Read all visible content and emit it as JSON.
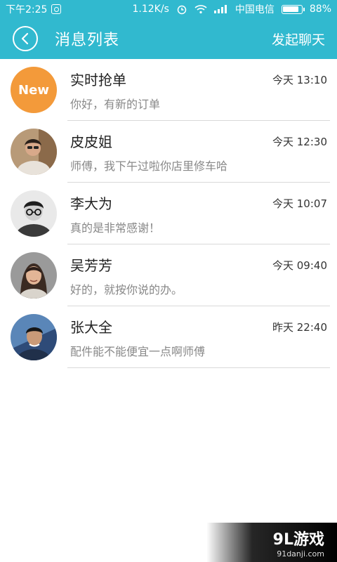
{
  "status_bar": {
    "time": "下午2:25",
    "net_speed": "1.12K/s",
    "carrier": "中国电信",
    "battery": "88%",
    "battery_level": 0.88
  },
  "app_bar": {
    "title": "消息列表",
    "action": "发起聊天"
  },
  "messages": [
    {
      "name": "实时抢单",
      "time": "今天 13:10",
      "preview": "你好，有新的订单",
      "avatar_text": "New"
    },
    {
      "name": "皮皮姐",
      "time": "今天 12:30",
      "preview": "师傅，我下午过啦你店里修车哈"
    },
    {
      "name": "李大为",
      "time": "今天 10:07",
      "preview": "真的是非常感谢！"
    },
    {
      "name": "吴芳芳",
      "time": "今天 09:40",
      "preview": "好的，就按你说的办。"
    },
    {
      "name": "张大全",
      "time": "昨天 22:40",
      "preview": "配件能不能便宜一点啊师傅"
    }
  ],
  "watermark": {
    "logo": "9L游戏",
    "url": "91danji.com"
  },
  "colors": {
    "primary": "#31b9cf",
    "new_badge": "#f39a3a"
  }
}
